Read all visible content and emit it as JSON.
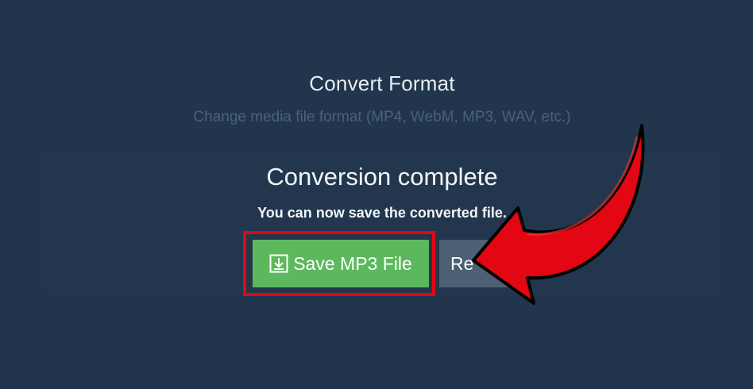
{
  "app": {
    "title": "Convert Format",
    "subtitle": "Change media file format (MP4, WebM, MP3, WAV, etc.)"
  },
  "result": {
    "heading": "Conversion complete",
    "message": "You can now save the converted file.",
    "save_button_label": "Save MP3 File",
    "second_button_label": "Re"
  },
  "icons": {
    "save": "download-icon",
    "annotation": "red-arrow-icon"
  },
  "colors": {
    "background": "#21364c",
    "save_button": "#5cb85c",
    "second_button": "#4d5f72",
    "annotation": "#e30613"
  }
}
